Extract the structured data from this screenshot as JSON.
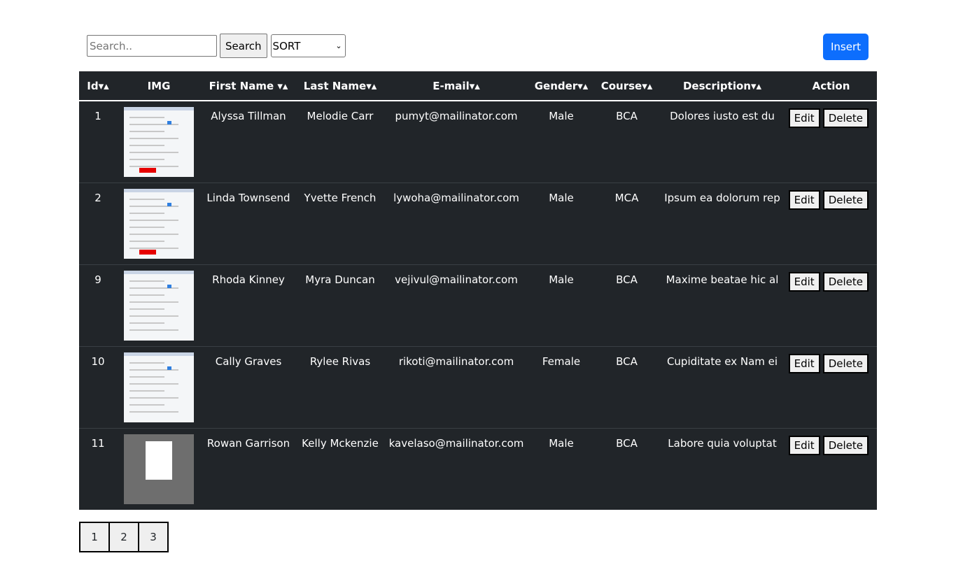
{
  "toolbar": {
    "search_placeholder": "Search..",
    "search_label": "Search",
    "sort_selected": "SORT",
    "insert_label": "Insert"
  },
  "table": {
    "headers": {
      "id": "Id▾▴",
      "img": "IMG",
      "first": "First Name ▾▴",
      "last": "Last Name▾▴",
      "email": "E-mail▾▴",
      "gender": "Gender▾▴",
      "course": "Course▾▴",
      "desc": "Description▾▴",
      "action": "Action"
    },
    "rows": [
      {
        "id": "1",
        "first": "Alyssa Tillman",
        "last": "Melodie Carr",
        "email": "pumyt@mailinator.com",
        "gender": "Male",
        "course": "BCA",
        "desc": "Dolores iusto est du",
        "thumb": "form"
      },
      {
        "id": "2",
        "first": "Linda Townsend",
        "last": "Yvette French",
        "email": "lywoha@mailinator.com",
        "gender": "Male",
        "course": "MCA",
        "desc": "Ipsum ea dolorum rep",
        "thumb": "form"
      },
      {
        "id": "9",
        "first": "Rhoda Kinney",
        "last": "Myra Duncan",
        "email": "vejivul@mailinator.com",
        "gender": "Male",
        "course": "BCA",
        "desc": "Maxime beatae hic al",
        "thumb": "table"
      },
      {
        "id": "10",
        "first": "Cally Graves",
        "last": "Rylee Rivas",
        "email": "rikoti@mailinator.com",
        "gender": "Female",
        "course": "BCA",
        "desc": "Cupiditate ex Nam ei",
        "thumb": "table"
      },
      {
        "id": "11",
        "first": "Rowan Garrison",
        "last": "Kelly Mckenzie",
        "email": "kavelaso@mailinator.com",
        "gender": "Male",
        "course": "BCA",
        "desc": "Labore quia voluptat",
        "thumb": "dialog"
      }
    ],
    "edit_label": "Edit",
    "delete_label": "Delete"
  },
  "pagination": [
    "1",
    "2",
    "3"
  ]
}
